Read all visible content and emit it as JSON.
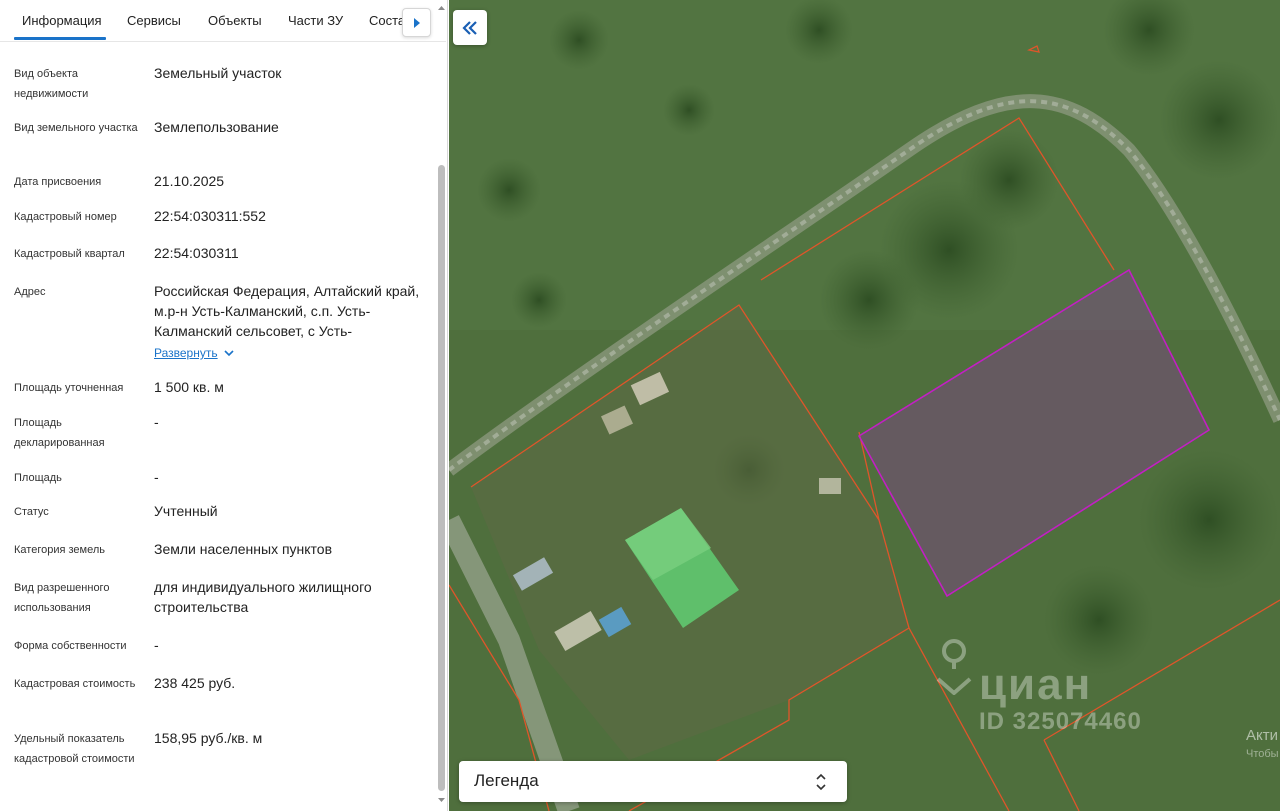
{
  "tabs": [
    {
      "label": "Информация",
      "active": true
    },
    {
      "label": "Сервисы"
    },
    {
      "label": "Объекты"
    },
    {
      "label": "Части ЗУ"
    },
    {
      "label": "Соста"
    }
  ],
  "fields": [
    {
      "label": "Вид объекта недвижимости",
      "value": "Земельный участок"
    },
    {
      "label": "Вид земельного участка",
      "value": "Землепользование"
    },
    {
      "label": "Дата присвоения",
      "value": "21.10.2025"
    },
    {
      "label": "Кадастровый номер",
      "value": "22:54:030311:552"
    },
    {
      "label": "Кадастровый квартал",
      "value": "22:54:030311"
    },
    {
      "label": "Адрес",
      "value": "Российская Федерация, Алтайский край, м.р-н Усть-Калманский, с.п. Усть-Калманский сельсовет, с Усть-",
      "expand_label": "Развернуть"
    },
    {
      "label": "Площадь уточненная",
      "value": "1 500 кв. м"
    },
    {
      "label": "Площадь декларированная",
      "value": "-"
    },
    {
      "label": "Площадь",
      "value": "-"
    },
    {
      "label": "Статус",
      "value": "Учтенный"
    },
    {
      "label": "Категория земель",
      "value": "Земли населенных пунктов"
    },
    {
      "label": "Вид разрешенного использования",
      "value": "для индивидуального жилищного строительства"
    },
    {
      "label": "Форма собственности",
      "value": "-"
    },
    {
      "label": "Кадастровая стоимость",
      "value": "238 425 руб."
    },
    {
      "label": "Удельный показатель кадастровой стоимости",
      "value": "158,95 руб./кв. м"
    }
  ],
  "map": {
    "legend_label": "Легенда",
    "watermark_brand": "циан",
    "watermark_id": "ID 325074460",
    "activation_text": "Акти",
    "activation_sub": "Чтобы"
  },
  "colors": {
    "accent": "#1a73c9",
    "parcel_border": "#e0552a",
    "selected_parcel": "#c21fc4"
  },
  "icons": {
    "tab_next": "triangle-right-icon",
    "collapse": "double-chevron-left-icon",
    "expand": "chevron-down-icon",
    "legend_toggle": "chevron-up-down-icon"
  }
}
